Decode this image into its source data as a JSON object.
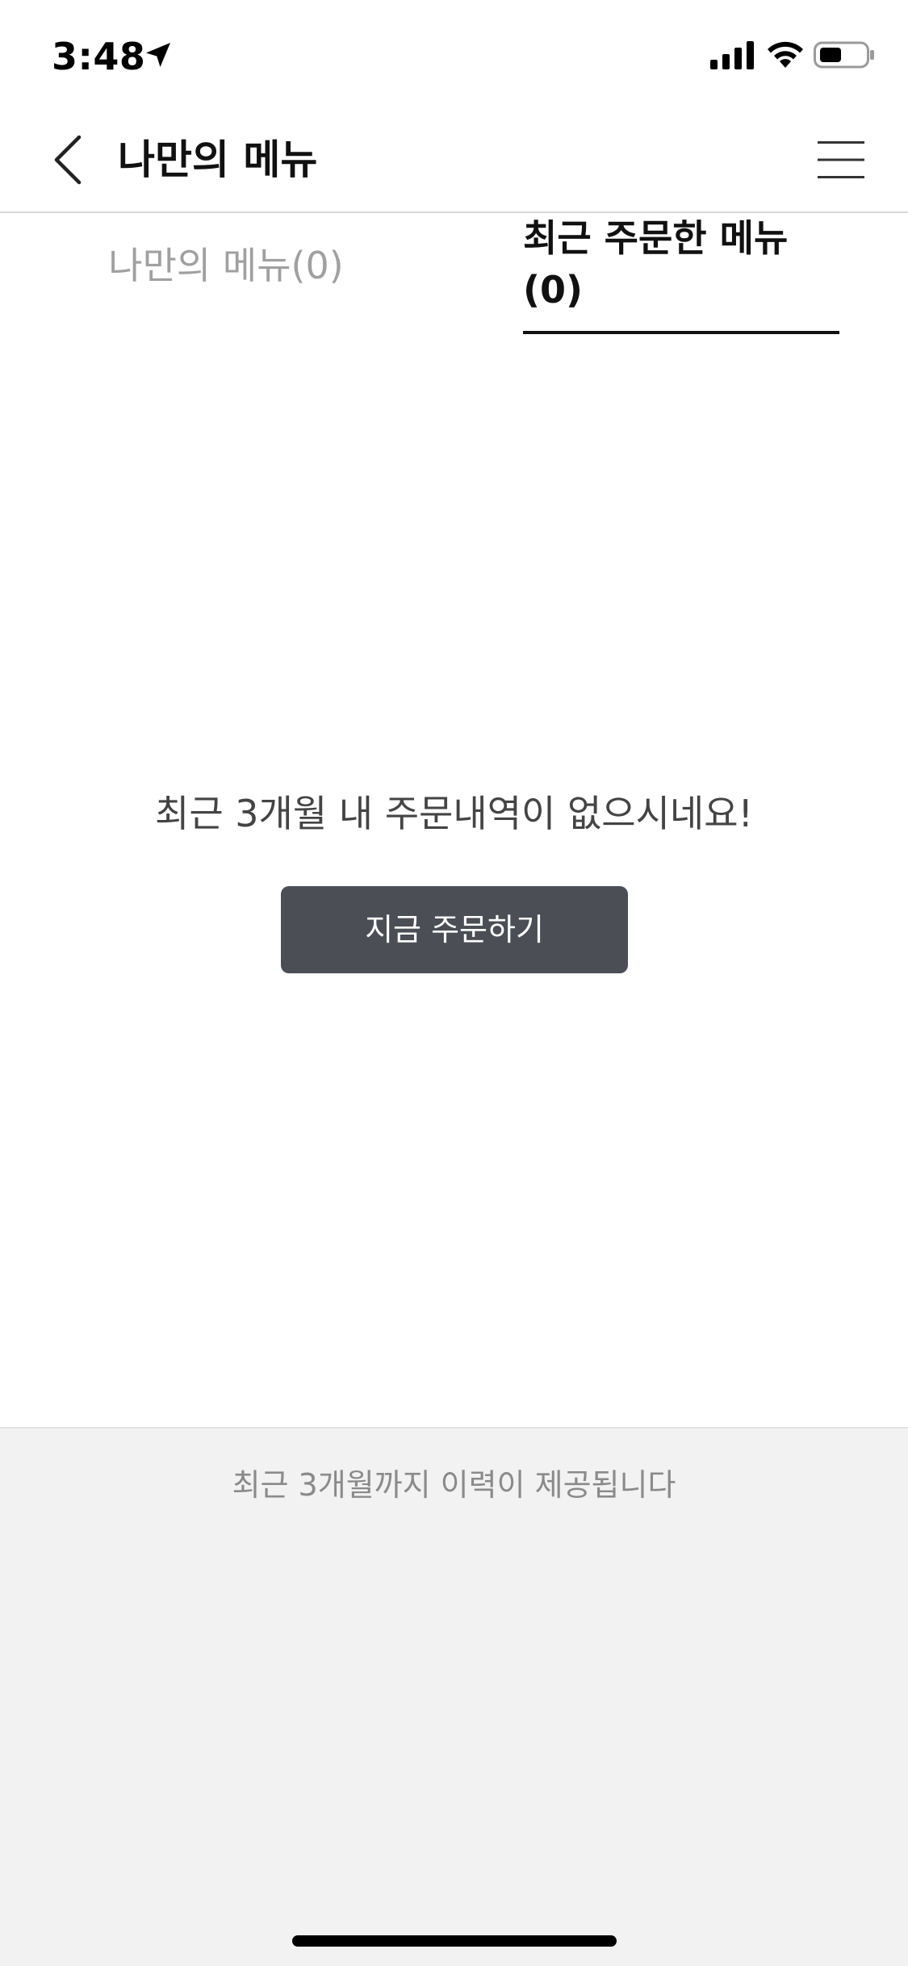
{
  "status_bar": {
    "time": "3:48",
    "icons": [
      "location-arrow-icon",
      "cellular-signal-icon",
      "wifi-icon",
      "battery-icon"
    ]
  },
  "header": {
    "title": "나만의 메뉴",
    "back_icon": "chevron-left-icon",
    "menu_icon": "hamburger-menu-icon"
  },
  "tabs": [
    {
      "label": "나만의 메뉴(0)",
      "active": false
    },
    {
      "label": "최근 주문한 메뉴(0)",
      "active": true
    }
  ],
  "empty_state": {
    "message": "최근 3개월 내 주문내역이 없으시네요!",
    "button_label": "지금 주문하기"
  },
  "footer": {
    "note": "최근 3개월까지 이력이 제공됩니다"
  },
  "colors": {
    "button_bg": "#4b4e55",
    "inactive_tab": "#a0a0a0",
    "footer_bg": "#f2f2f2"
  }
}
